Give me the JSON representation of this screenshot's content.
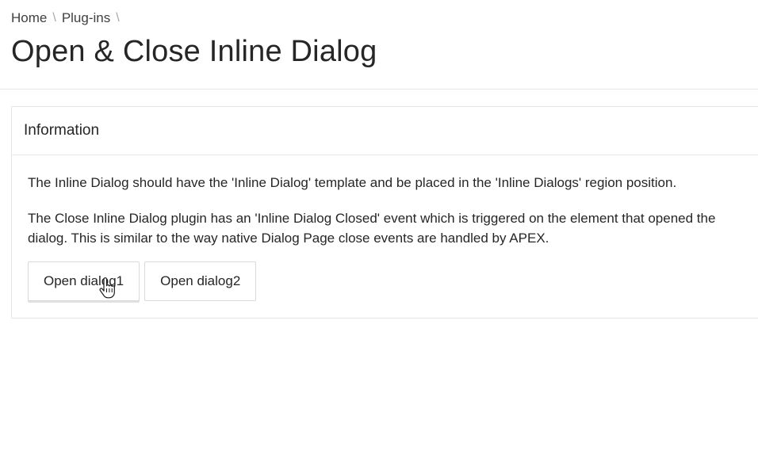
{
  "breadcrumb": {
    "items": [
      {
        "label": "Home"
      },
      {
        "label": "Plug-ins"
      }
    ],
    "separator": "\\"
  },
  "page": {
    "title": "Open & Close Inline Dialog"
  },
  "region": {
    "title": "Information",
    "paragraphs": [
      "The Inline Dialog should have the 'Inline Dialog' template and be placed in the 'Inline Dialogs' region position.",
      "The Close Inline Dialog plugin has an 'Inline Dialog Closed' event which is triggered on the element that opened the dialog. This is similar to the way native Dialog Page close events are handled by APEX."
    ],
    "buttons": [
      {
        "label": "Open dialog1"
      },
      {
        "label": "Open dialog2"
      }
    ]
  },
  "cursor": {
    "icon": "hand-pointer-icon"
  }
}
